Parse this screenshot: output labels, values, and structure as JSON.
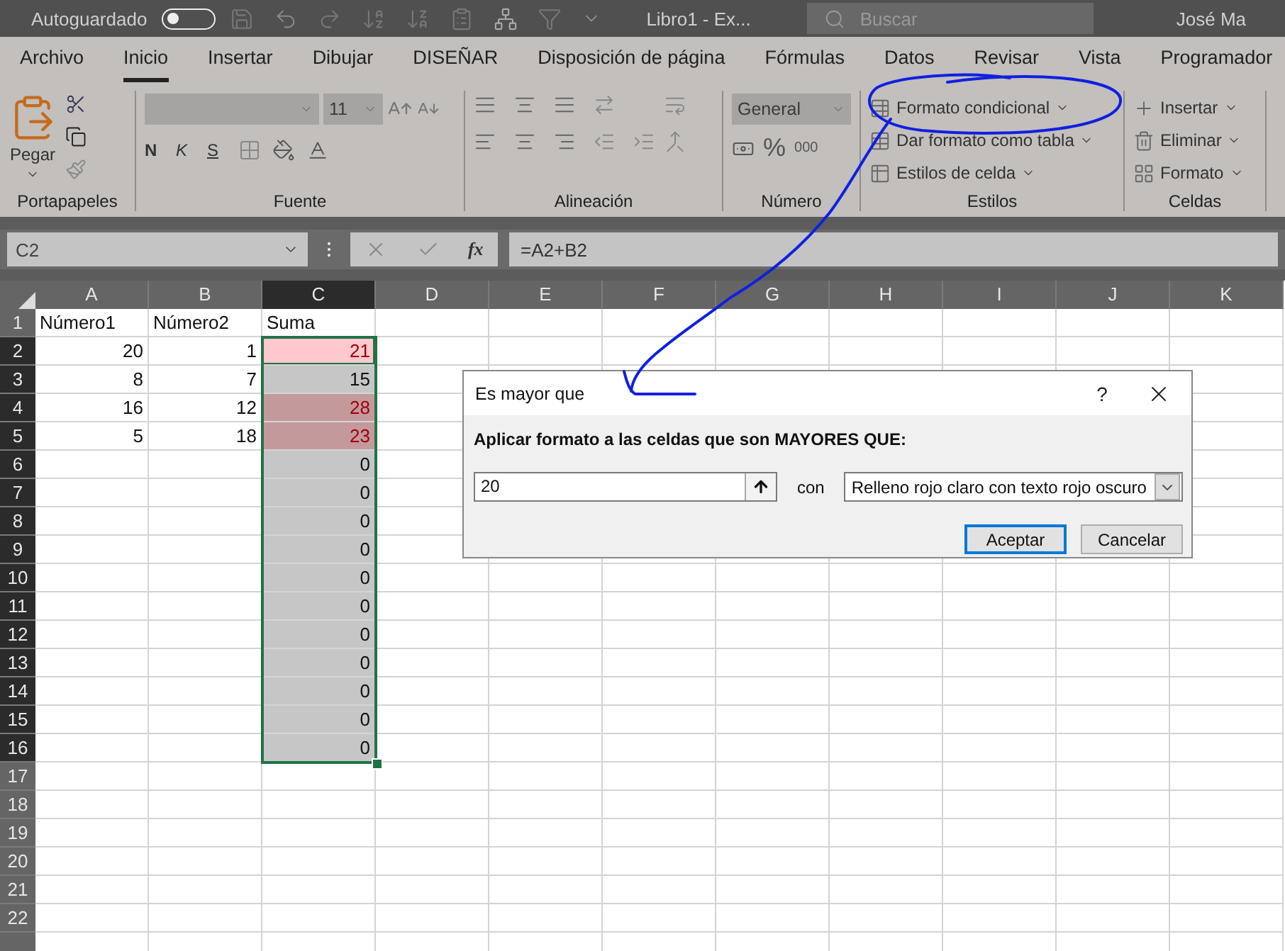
{
  "title_bar": {
    "autosave_label": "Autoguardado",
    "autosave_on": false,
    "file_title": "Libro1  -  Ex...",
    "search_placeholder": "Buscar",
    "user": "José Ma"
  },
  "ribbon_tabs": [
    {
      "label": "Archivo",
      "selected": false
    },
    {
      "label": "Inicio",
      "selected": true
    },
    {
      "label": "Insertar",
      "selected": false
    },
    {
      "label": "Dibujar",
      "selected": false
    },
    {
      "label": "DISEÑAR",
      "selected": false
    },
    {
      "label": "Disposición de página",
      "selected": false
    },
    {
      "label": "Fórmulas",
      "selected": false
    },
    {
      "label": "Datos",
      "selected": false
    },
    {
      "label": "Revisar",
      "selected": false
    },
    {
      "label": "Vista",
      "selected": false
    },
    {
      "label": "Programador",
      "selected": false
    }
  ],
  "ribbon": {
    "clipboard": {
      "paste": "Pegar",
      "label": "Portapapeles"
    },
    "font": {
      "size": "11",
      "styles": [
        "N",
        "K",
        "S"
      ],
      "label": "Fuente"
    },
    "alignment": {
      "label": "Alineación"
    },
    "number": {
      "format": "General",
      "percent": "%",
      "thousands": "000",
      "label": "Número"
    },
    "styles": {
      "items": [
        "Formato condicional",
        "Dar formato como tabla",
        "Estilos de celda"
      ],
      "label": "Estilos"
    },
    "cells": {
      "items": [
        "Insertar",
        "Eliminar",
        "Formato"
      ],
      "label": "Celdas"
    }
  },
  "formula_bar": {
    "name_box": "C2",
    "fx": "fx",
    "formula": "=A2+B2"
  },
  "sheet": {
    "columns": [
      {
        "label": "A",
        "selected": false
      },
      {
        "label": "B",
        "selected": false
      },
      {
        "label": "C",
        "selected": true
      },
      {
        "label": "D",
        "selected": false
      },
      {
        "label": "E",
        "selected": false
      },
      {
        "label": "F",
        "selected": false
      },
      {
        "label": "G",
        "selected": false
      },
      {
        "label": "H",
        "selected": false
      },
      {
        "label": "I",
        "selected": false
      },
      {
        "label": "J",
        "selected": false
      },
      {
        "label": "K",
        "selected": false
      }
    ],
    "rows": [
      {
        "number": "1",
        "selected": false,
        "conditional": false,
        "active": false,
        "cells": [
          {
            "text": "Número1",
            "kind": "text"
          },
          {
            "text": "Número2",
            "kind": "text"
          },
          {
            "text": "Suma",
            "kind": "text"
          }
        ]
      },
      {
        "number": "2",
        "selected": true,
        "conditional": true,
        "active": true,
        "cells": [
          {
            "text": "20",
            "kind": "number"
          },
          {
            "text": "1",
            "kind": "number"
          },
          {
            "text": "21",
            "kind": "number"
          }
        ]
      },
      {
        "number": "3",
        "selected": true,
        "conditional": false,
        "active": false,
        "cells": [
          {
            "text": "8",
            "kind": "number"
          },
          {
            "text": "7",
            "kind": "number"
          },
          {
            "text": "15",
            "kind": "number"
          }
        ]
      },
      {
        "number": "4",
        "selected": true,
        "conditional": true,
        "active": false,
        "cells": [
          {
            "text": "16",
            "kind": "number"
          },
          {
            "text": "12",
            "kind": "number"
          },
          {
            "text": "28",
            "kind": "number"
          }
        ]
      },
      {
        "number": "5",
        "selected": true,
        "conditional": true,
        "active": false,
        "cells": [
          {
            "text": "5",
            "kind": "number"
          },
          {
            "text": "18",
            "kind": "number"
          },
          {
            "text": "23",
            "kind": "number"
          }
        ]
      },
      {
        "number": "6",
        "selected": true,
        "conditional": false,
        "active": false,
        "cells": [
          null,
          null,
          {
            "text": "0",
            "kind": "number"
          }
        ]
      },
      {
        "number": "7",
        "selected": true,
        "conditional": false,
        "active": false,
        "cells": [
          null,
          null,
          {
            "text": "0",
            "kind": "number"
          }
        ]
      },
      {
        "number": "8",
        "selected": true,
        "conditional": false,
        "active": false,
        "cells": [
          null,
          null,
          {
            "text": "0",
            "kind": "number"
          }
        ]
      },
      {
        "number": "9",
        "selected": true,
        "conditional": false,
        "active": false,
        "cells": [
          null,
          null,
          {
            "text": "0",
            "kind": "number"
          }
        ]
      },
      {
        "number": "10",
        "selected": true,
        "conditional": false,
        "active": false,
        "cells": [
          null,
          null,
          {
            "text": "0",
            "kind": "number"
          }
        ]
      },
      {
        "number": "11",
        "selected": true,
        "conditional": false,
        "active": false,
        "cells": [
          null,
          null,
          {
            "text": "0",
            "kind": "number"
          }
        ]
      },
      {
        "number": "12",
        "selected": true,
        "conditional": false,
        "active": false,
        "cells": [
          null,
          null,
          {
            "text": "0",
            "kind": "number"
          }
        ]
      },
      {
        "number": "13",
        "selected": true,
        "conditional": false,
        "active": false,
        "cells": [
          null,
          null,
          {
            "text": "0",
            "kind": "number"
          }
        ]
      },
      {
        "number": "14",
        "selected": true,
        "conditional": false,
        "active": false,
        "cells": [
          null,
          null,
          {
            "text": "0",
            "kind": "number"
          }
        ]
      },
      {
        "number": "15",
        "selected": true,
        "conditional": false,
        "active": false,
        "cells": [
          null,
          null,
          {
            "text": "0",
            "kind": "number"
          }
        ]
      },
      {
        "number": "16",
        "selected": true,
        "conditional": false,
        "active": false,
        "cells": [
          null,
          null,
          {
            "text": "0",
            "kind": "number"
          }
        ]
      },
      {
        "number": "17",
        "selected": false,
        "conditional": false,
        "active": false,
        "cells": []
      },
      {
        "number": "18",
        "selected": false,
        "conditional": false,
        "active": false,
        "cells": []
      },
      {
        "number": "19",
        "selected": false,
        "conditional": false,
        "active": false,
        "cells": []
      },
      {
        "number": "20",
        "selected": false,
        "conditional": false,
        "active": false,
        "cells": []
      },
      {
        "number": "21",
        "selected": false,
        "conditional": false,
        "active": false,
        "cells": []
      },
      {
        "number": "22",
        "selected": false,
        "conditional": false,
        "active": false,
        "cells": []
      },
      {
        "selected": false,
        "conditional": false,
        "active": false,
        "cells": []
      }
    ]
  },
  "dialog": {
    "title": "Es mayor que",
    "help": "?",
    "prompt": "Aplicar formato a las celdas que son MAYORES QUE:",
    "value": "20",
    "connector": "con",
    "format": "Relleno rojo claro con texto rojo oscuro",
    "buttons": [
      {
        "label": "Aceptar",
        "default": true
      },
      {
        "label": "Cancelar",
        "default": false
      }
    ]
  }
}
